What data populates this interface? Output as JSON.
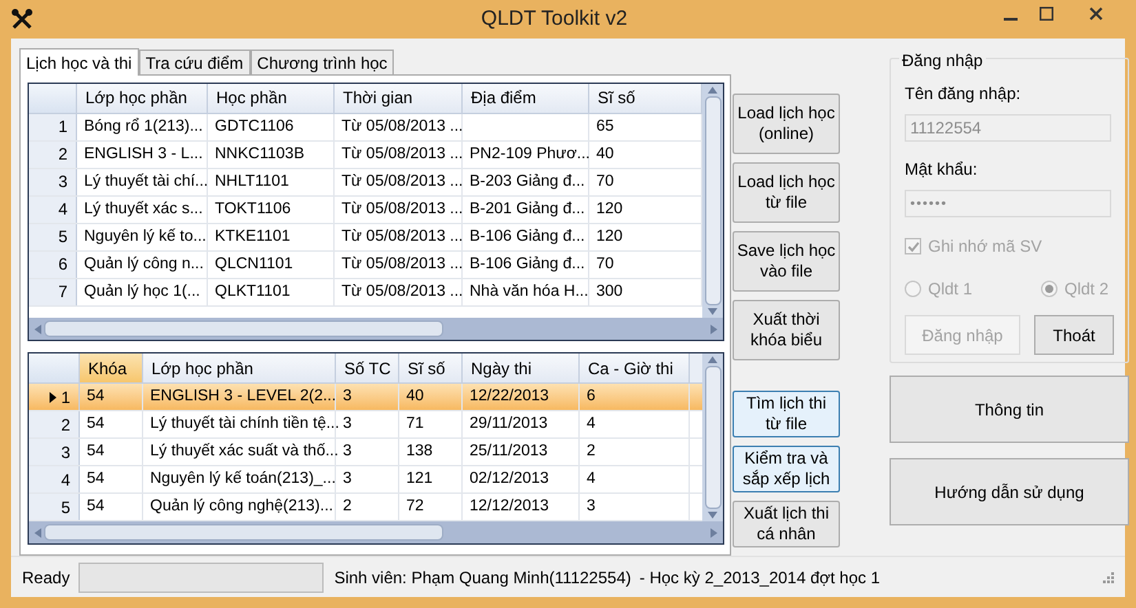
{
  "window": {
    "title": "QLDT Toolkit v2"
  },
  "tabs": [
    {
      "label": "Lịch học và thi",
      "selected": true
    },
    {
      "label": "Tra cứu điểm",
      "selected": false
    },
    {
      "label": "Chương trình học",
      "selected": false
    }
  ],
  "schedule_table": {
    "columns": [
      {
        "label": "Lớp học phần",
        "selected": false
      },
      {
        "label": "Học phần",
        "selected": false
      },
      {
        "label": "Thời gian",
        "selected": false
      },
      {
        "label": "Địa điểm",
        "selected": false
      },
      {
        "label": "Sĩ số",
        "selected": false
      }
    ],
    "rows": [
      {
        "index": "1",
        "selected": false,
        "cells": [
          "Bóng rổ 1(213)...",
          "GDTC1106",
          "Từ 05/08/2013 ...",
          "",
          "65"
        ]
      },
      {
        "index": "2",
        "selected": false,
        "cells": [
          "ENGLISH 3 - L...",
          "NNKC1103B",
          "Từ 05/08/2013 ...",
          "PN2-109 Phươ...",
          "40"
        ]
      },
      {
        "index": "3",
        "selected": false,
        "cells": [
          "Lý thuyết tài chí...",
          "NHLT1101",
          "Từ 05/08/2013 ...",
          "B-203 Giảng đ...",
          "70"
        ]
      },
      {
        "index": "4",
        "selected": false,
        "cells": [
          "Lý thuyết xác s...",
          "TOKT1106",
          "Từ 05/08/2013 ...",
          "B-201 Giảng đ...",
          "120"
        ]
      },
      {
        "index": "5",
        "selected": false,
        "cells": [
          "Nguyên lý kế to...",
          "KTKE1101",
          "Từ 05/08/2013 ...",
          "B-106 Giảng đ...",
          "120"
        ]
      },
      {
        "index": "6",
        "selected": false,
        "cells": [
          "Quản lý công n...",
          "QLCN1101",
          "Từ 05/08/2013 ...",
          "B-106 Giảng đ...",
          "70"
        ]
      },
      {
        "index": "7",
        "selected": false,
        "cells": [
          "Quản lý học 1(...",
          "QLKT1101",
          "Từ 05/08/2013 ...",
          "Nhà văn hóa H...",
          "300"
        ]
      }
    ]
  },
  "exam_table": {
    "columns": [
      {
        "label": "Khóa",
        "selected": true
      },
      {
        "label": "Lớp học phần",
        "selected": false
      },
      {
        "label": "Số TC",
        "selected": false
      },
      {
        "label": "Sĩ số",
        "selected": false
      },
      {
        "label": "Ngày thi",
        "selected": false
      },
      {
        "label": "Ca - Giờ thi",
        "selected": false
      }
    ],
    "rows": [
      {
        "index": "1",
        "selected": true,
        "cells": [
          "54",
          "ENGLISH 3 - LEVEL 2(2...",
          "3",
          "40",
          "12/22/2013",
          "6"
        ]
      },
      {
        "index": "2",
        "selected": false,
        "cells": [
          "54",
          "Lý thuyết tài chính tiền tệ...",
          "3",
          "71",
          "29/11/2013",
          "4"
        ]
      },
      {
        "index": "3",
        "selected": false,
        "cells": [
          "54",
          "Lý thuyết xác suất và thố...",
          "3",
          "138",
          "25/11/2013",
          "2"
        ]
      },
      {
        "index": "4",
        "selected": false,
        "cells": [
          "54",
          "Nguyên lý kế toán(213)_...",
          "3",
          "121",
          "02/12/2013",
          "4"
        ]
      },
      {
        "index": "5",
        "selected": false,
        "cells": [
          "54",
          "Quản lý công nghệ(213)...",
          "2",
          "72",
          "12/12/2013",
          "3"
        ]
      }
    ]
  },
  "schedule_buttons": [
    {
      "label": "Load lịch học (online)",
      "highlighted": false
    },
    {
      "label": "Load lịch học từ file",
      "highlighted": false
    },
    {
      "label": "Save lịch học vào file",
      "highlighted": false
    },
    {
      "label": "Xuất thời khóa biểu",
      "highlighted": false
    }
  ],
  "exam_buttons": [
    {
      "label": "Tìm lịch thi từ file",
      "highlighted": true
    },
    {
      "label": "Kiểm tra và sắp xếp lịch",
      "highlighted": true
    },
    {
      "label": "Xuất lịch thi cá nhân",
      "highlighted": false
    }
  ],
  "login": {
    "title": "Đăng nhập",
    "username_label": "Tên đăng nhập:",
    "username": "11122554",
    "password_label": "Mật khẩu:",
    "password": "••••••",
    "fields_disabled": true,
    "remember": {
      "label": "Ghi nhớ mã SV",
      "checked": true,
      "disabled": true
    },
    "servers": [
      {
        "label": "Qldt 1",
        "selected": false,
        "disabled": true
      },
      {
        "label": "Qldt 2",
        "selected": true,
        "disabled": true
      }
    ],
    "buttons": [
      {
        "label": "Đăng nhập",
        "disabled": true
      },
      {
        "label": "Thoát",
        "disabled": false
      }
    ]
  },
  "side_buttons": [
    "Thông tin",
    "Hướng dẫn sử dụng"
  ],
  "status_bar": {
    "status": "Ready",
    "student": "Sinh viên: Phạm Quang Minh(11122554)",
    "term": "- Học kỳ 2_2013_2014 đợt học 1"
  }
}
